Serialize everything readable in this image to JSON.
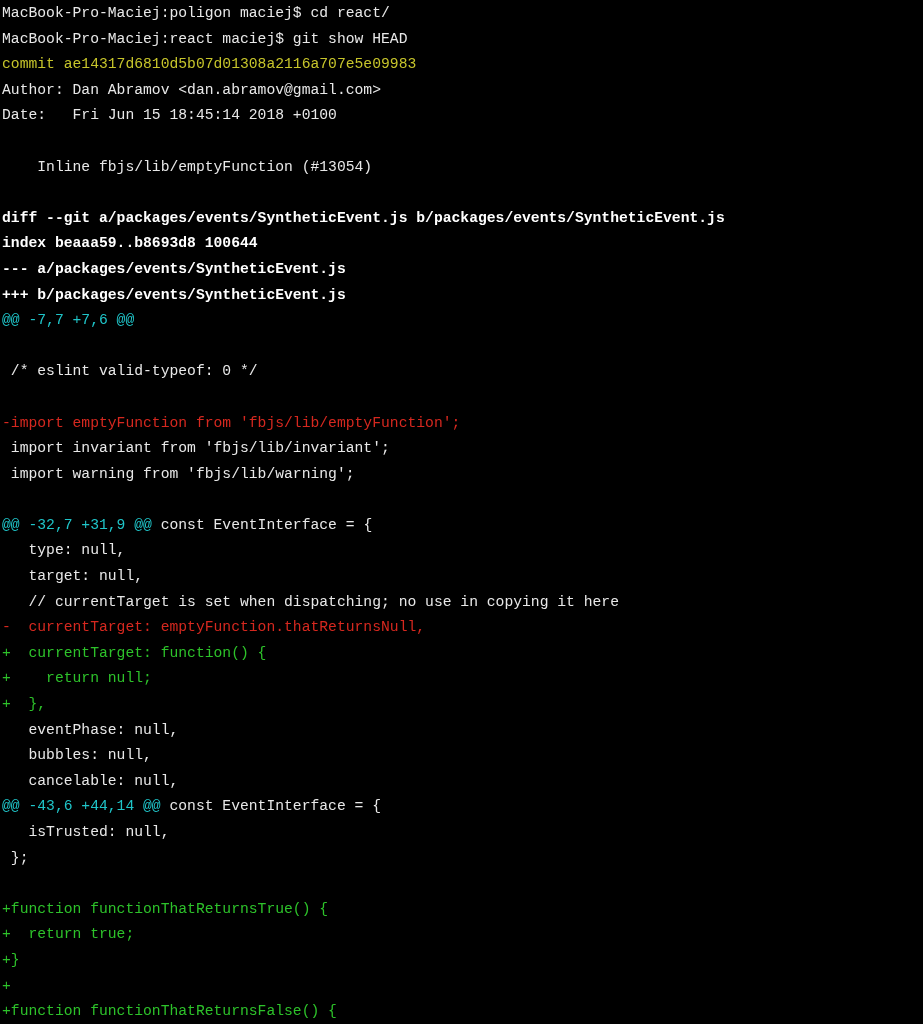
{
  "terminal": {
    "lines": [
      {
        "kind": "prompt",
        "text": "MacBook-Pro-Maciej:poligon maciej$ cd react/"
      },
      {
        "kind": "prompt",
        "text": "MacBook-Pro-Maciej:react maciej$ git show HEAD"
      },
      {
        "kind": "commit",
        "text": "commit ae14317d6810d5b07d01308a2116a707e5e09983"
      },
      {
        "kind": "plain",
        "text": "Author: Dan Abramov <dan.abramov@gmail.com>"
      },
      {
        "kind": "plain",
        "text": "Date:   Fri Jun 15 18:45:14 2018 +0100"
      },
      {
        "kind": "blank"
      },
      {
        "kind": "plain",
        "text": "    Inline fbjs/lib/emptyFunction (#13054)"
      },
      {
        "kind": "blank"
      },
      {
        "kind": "meta",
        "text": "diff --git a/packages/events/SyntheticEvent.js b/packages/events/SyntheticEvent.js"
      },
      {
        "kind": "meta",
        "text": "index beaaa59..b8693d8 100644"
      },
      {
        "kind": "meta",
        "text": "--- a/packages/events/SyntheticEvent.js"
      },
      {
        "kind": "meta",
        "text": "+++ b/packages/events/SyntheticEvent.js"
      },
      {
        "kind": "hunk",
        "text": "@@ -7,7 +7,6 @@"
      },
      {
        "kind": "blank"
      },
      {
        "kind": "plain",
        "text": " /* eslint valid-typeof: 0 */"
      },
      {
        "kind": "blank"
      },
      {
        "kind": "removed",
        "text": "-import emptyFunction from 'fbjs/lib/emptyFunction';"
      },
      {
        "kind": "plain",
        "text": " import invariant from 'fbjs/lib/invariant';"
      },
      {
        "kind": "plain",
        "text": " import warning from 'fbjs/lib/warning';"
      },
      {
        "kind": "blank"
      },
      {
        "kind": "hunk",
        "text": "@@ -32,7 +31,9 @@",
        "context": " const EventInterface = {"
      },
      {
        "kind": "plain",
        "text": "   type: null,"
      },
      {
        "kind": "plain",
        "text": "   target: null,"
      },
      {
        "kind": "plain",
        "text": "   // currentTarget is set when dispatching; no use in copying it here"
      },
      {
        "kind": "removed",
        "text": "-  currentTarget: emptyFunction.thatReturnsNull,"
      },
      {
        "kind": "added",
        "text": "+  currentTarget: function() {"
      },
      {
        "kind": "added",
        "text": "+    return null;"
      },
      {
        "kind": "added",
        "text": "+  },"
      },
      {
        "kind": "plain",
        "text": "   eventPhase: null,"
      },
      {
        "kind": "plain",
        "text": "   bubbles: null,"
      },
      {
        "kind": "plain",
        "text": "   cancelable: null,"
      },
      {
        "kind": "hunk",
        "text": "@@ -43,6 +44,14 @@",
        "context": " const EventInterface = {"
      },
      {
        "kind": "plain",
        "text": "   isTrusted: null,"
      },
      {
        "kind": "plain",
        "text": " };"
      },
      {
        "kind": "blank"
      },
      {
        "kind": "added",
        "text": "+function functionThatReturnsTrue() {"
      },
      {
        "kind": "added",
        "text": "+  return true;"
      },
      {
        "kind": "added",
        "text": "+}"
      },
      {
        "kind": "added",
        "text": "+"
      },
      {
        "kind": "added",
        "text": "+function functionThatReturnsFalse() {"
      }
    ]
  }
}
